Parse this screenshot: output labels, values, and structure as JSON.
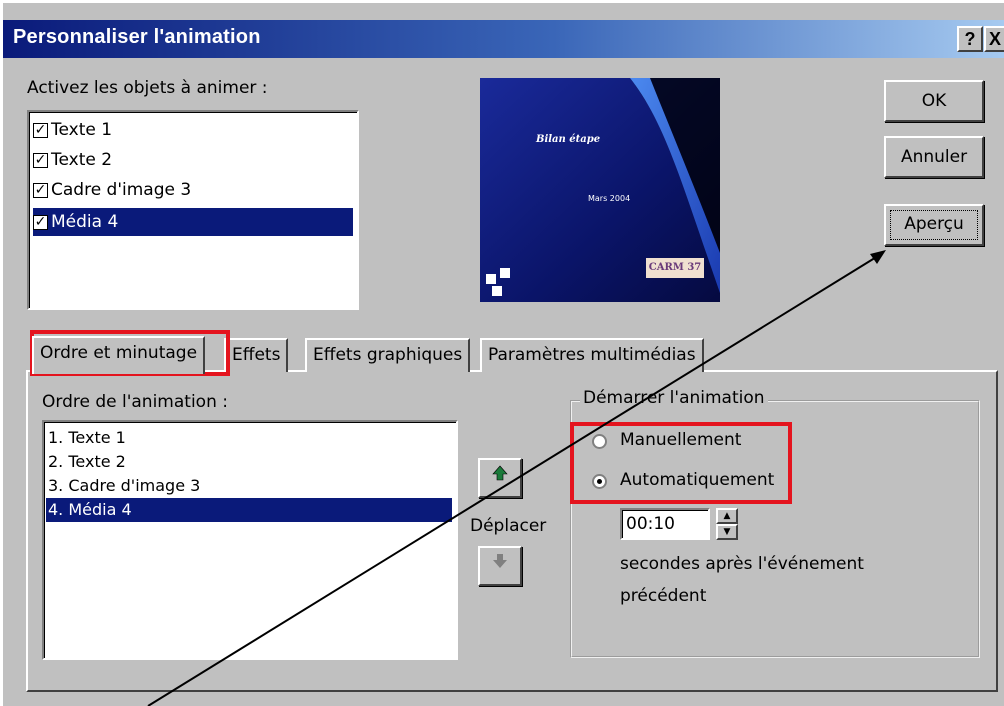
{
  "window": {
    "title": "Personnaliser l'animation",
    "help_btn": "?",
    "close_btn": "X"
  },
  "objects": {
    "label": "Activez les objets à animer :",
    "items": [
      {
        "label": "Texte 1",
        "checked": true
      },
      {
        "label": "Texte 2",
        "checked": true
      },
      {
        "label": "Cadre d'image 3",
        "checked": true
      },
      {
        "label": "Média 4",
        "checked": true,
        "selected": true
      }
    ]
  },
  "preview": {
    "slide_title": "Bilan étape",
    "slide_date": "Mars 2004",
    "slide_logo": "CARM 37"
  },
  "buttons": {
    "ok": "OK",
    "cancel": "Annuler",
    "preview": "Aperçu"
  },
  "tabs": [
    {
      "label": "Ordre et minutage",
      "active": true
    },
    {
      "label": "Effets"
    },
    {
      "label": "Effets graphiques"
    },
    {
      "label": "Paramètres multimédias"
    }
  ],
  "order": {
    "label": "Ordre de l'animation :",
    "items": [
      "1. Texte 1",
      "2. Texte 2",
      "3. Cadre d'image 3",
      "4. Média 4"
    ],
    "selected_index": 3,
    "move_label": "Déplacer"
  },
  "start": {
    "group_label": "Démarrer l'animation",
    "manual": "Manuellement",
    "auto": "Automatiquement",
    "selected": "auto",
    "time": "00:10",
    "desc_line1": "secondes après l'événement",
    "desc_line2": "précédent"
  },
  "colors": {
    "highlight": "#e4141e",
    "selection": "#0a1a7a",
    "dialog_bg": "#c0c0c0"
  }
}
